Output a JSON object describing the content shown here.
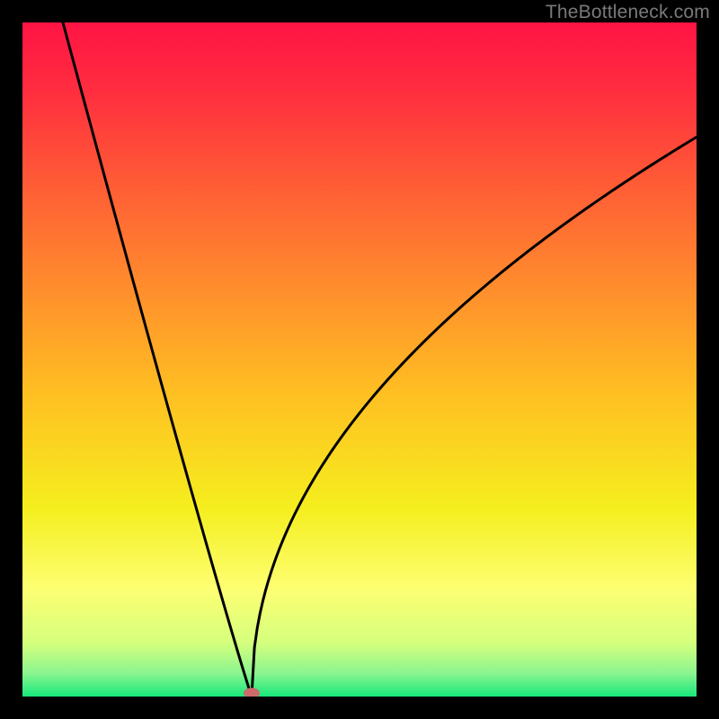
{
  "watermark": "TheBottleneck.com",
  "chart_data": {
    "type": "line",
    "title": "",
    "xlabel": "",
    "ylabel": "",
    "xlim": [
      0,
      1
    ],
    "ylim": [
      0,
      1
    ],
    "minimum_point": {
      "x": 0.34,
      "y": 0.0
    },
    "left_branch_start": {
      "x": 0.06,
      "y": 1.0
    },
    "right_branch_end": {
      "x": 1.0,
      "y": 0.83
    },
    "background_gradient": [
      {
        "stop": 0.0,
        "color": "#ff1444"
      },
      {
        "stop": 0.1,
        "color": "#ff2d3f"
      },
      {
        "stop": 0.25,
        "color": "#ff5f35"
      },
      {
        "stop": 0.4,
        "color": "#ff8f2c"
      },
      {
        "stop": 0.55,
        "color": "#ffbf22"
      },
      {
        "stop": 0.72,
        "color": "#f5ee1e"
      },
      {
        "stop": 0.84,
        "color": "#fdff72"
      },
      {
        "stop": 0.92,
        "color": "#d6ff7d"
      },
      {
        "stop": 0.965,
        "color": "#8cf58f"
      },
      {
        "stop": 1.0,
        "color": "#17e87c"
      }
    ],
    "marker": {
      "x": 0.34,
      "y": 0.005,
      "color": "#cc6b6b"
    },
    "curve_color": "#000000",
    "curve_width": 3
  }
}
